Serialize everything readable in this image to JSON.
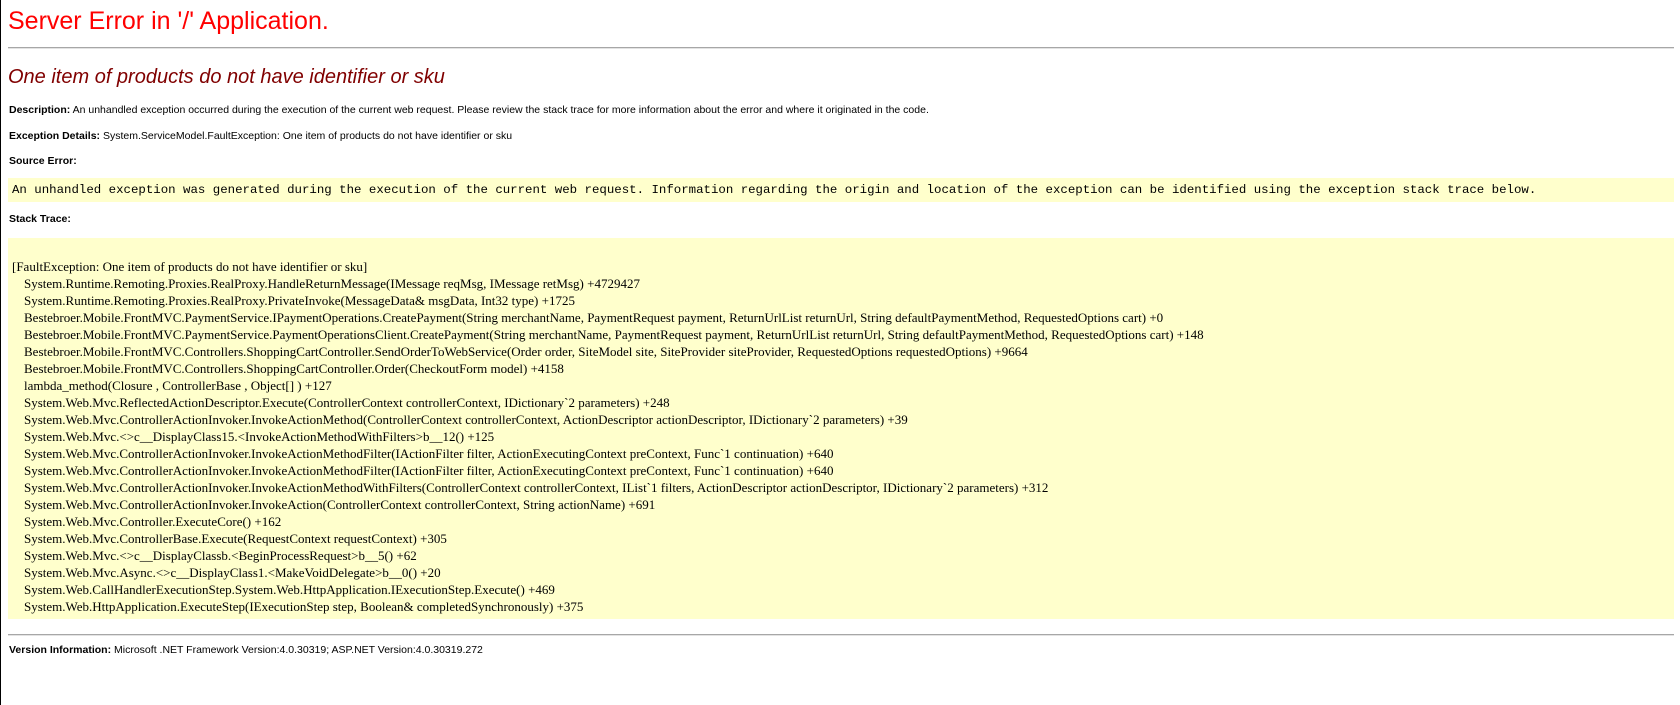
{
  "header": {
    "title": "Server Error in '/' Application.",
    "error_message": "One item of products do not have identifier or sku"
  },
  "description": {
    "label": "Description:",
    "text": "An unhandled exception occurred during the execution of the current web request. Please review the stack trace for more information about the error and where it originated in the code."
  },
  "exception_details": {
    "label": "Exception Details:",
    "text": "System.ServiceModel.FaultException: One item of products do not have identifier or sku"
  },
  "source_error": {
    "label": "Source Error:",
    "text": "An unhandled exception was generated during the execution of the current web request. Information regarding the origin and location of the exception can be identified using the exception stack trace below."
  },
  "stack_trace": {
    "label": "Stack Trace:",
    "lines": [
      "[FaultException: One item of products do not have identifier or sku]",
      "System.Runtime.Remoting.Proxies.RealProxy.HandleReturnMessage(IMessage reqMsg, IMessage retMsg) +4729427",
      "System.Runtime.Remoting.Proxies.RealProxy.PrivateInvoke(MessageData& msgData, Int32 type) +1725",
      "Bestebroer.Mobile.FrontMVC.PaymentService.IPaymentOperations.CreatePayment(String merchantName, PaymentRequest payment, ReturnUrlList returnUrl, String defaultPaymentMethod, RequestedOptions cart) +0",
      "Bestebroer.Mobile.FrontMVC.PaymentService.PaymentOperationsClient.CreatePayment(String merchantName, PaymentRequest payment, ReturnUrlList returnUrl, String defaultPaymentMethod, RequestedOptions cart) +148",
      "Bestebroer.Mobile.FrontMVC.Controllers.ShoppingCartController.SendOrderToWebService(Order order, SiteModel site, SiteProvider siteProvider, RequestedOptions requestedOptions) +9664",
      "Bestebroer.Mobile.FrontMVC.Controllers.ShoppingCartController.Order(CheckoutForm model) +4158",
      "lambda_method(Closure , ControllerBase , Object[] ) +127",
      "System.Web.Mvc.ReflectedActionDescriptor.Execute(ControllerContext controllerContext, IDictionary`2 parameters) +248",
      "System.Web.Mvc.ControllerActionInvoker.InvokeActionMethod(ControllerContext controllerContext, ActionDescriptor actionDescriptor, IDictionary`2 parameters) +39",
      "System.Web.Mvc.<>c__DisplayClass15.<InvokeActionMethodWithFilters>b__12() +125",
      "System.Web.Mvc.ControllerActionInvoker.InvokeActionMethodFilter(IActionFilter filter, ActionExecutingContext preContext, Func`1 continuation) +640",
      "System.Web.Mvc.ControllerActionInvoker.InvokeActionMethodFilter(IActionFilter filter, ActionExecutingContext preContext, Func`1 continuation) +640",
      "System.Web.Mvc.ControllerActionInvoker.InvokeActionMethodWithFilters(ControllerContext controllerContext, IList`1 filters, ActionDescriptor actionDescriptor, IDictionary`2 parameters) +312",
      "System.Web.Mvc.ControllerActionInvoker.InvokeAction(ControllerContext controllerContext, String actionName) +691",
      "System.Web.Mvc.Controller.ExecuteCore() +162",
      "System.Web.Mvc.ControllerBase.Execute(RequestContext requestContext) +305",
      "System.Web.Mvc.<>c__DisplayClassb.<BeginProcessRequest>b__5() +62",
      "System.Web.Mvc.Async.<>c__DisplayClass1.<MakeVoidDelegate>b__0() +20",
      "System.Web.CallHandlerExecutionStep.System.Web.HttpApplication.IExecutionStep.Execute() +469",
      "System.Web.HttpApplication.ExecuteStep(IExecutionStep step, Boolean& completedSynchronously) +375"
    ]
  },
  "version_information": {
    "label": "Version Information:",
    "text": "Microsoft .NET Framework Version:4.0.30319; ASP.NET Version:4.0.30319.272"
  },
  "colors": {
    "title": "#ff0000",
    "error_message": "#800000",
    "code_background": "#ffffcc",
    "rule": "#a7a7a7"
  }
}
